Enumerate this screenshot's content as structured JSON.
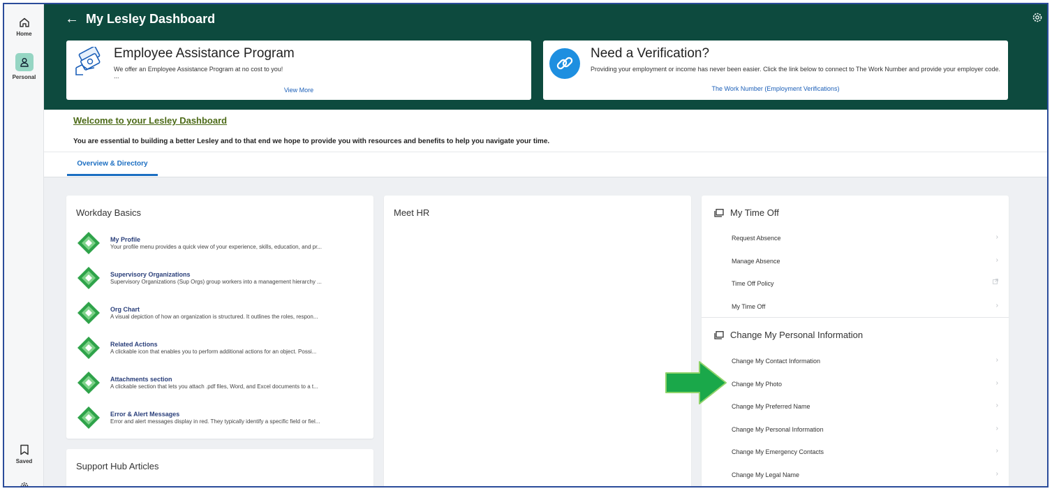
{
  "rail": {
    "home_label": "Home",
    "personal_label": "Personal",
    "saved_label": "Saved"
  },
  "header": {
    "title": "My Lesley Dashboard"
  },
  "promos": {
    "eap": {
      "title": "Employee Assistance Program",
      "description": "We offer an Employee Assistance Program at no cost to you!",
      "ellipsis": "...",
      "link": "View More"
    },
    "verification": {
      "title": "Need a Verification?",
      "description": "Providing your employment or income has never been easier. Click the link below to connect to The Work Number and provide your employer code.",
      "link": "The Work Number (Employment Verifications)"
    }
  },
  "welcome": {
    "heading": "Welcome to your Lesley Dashboard",
    "text": "You are essential to building a better Lesley and to that end we hope to provide you with resources and benefits to help you navigate your time."
  },
  "tabs": [
    {
      "label": "Overview & Directory",
      "active": true
    }
  ],
  "workday_basics": {
    "title": "Workday Basics",
    "items": [
      {
        "title": "My Profile",
        "desc": "Your profile menu provides a quick view of your experience, skills, education, and pr..."
      },
      {
        "title": "Supervisory Organizations",
        "desc": "Supervisory Organizations (Sup Orgs) group workers into a management hierarchy ..."
      },
      {
        "title": "Org Chart",
        "desc": "A visual depiction of how an organization is structured. It outlines the roles, respon..."
      },
      {
        "title": "Related Actions",
        "desc": "A clickable icon that enables you to perform additional actions for an object. Possi..."
      },
      {
        "title": "Attachments section",
        "desc": "A clickable section that lets you attach .pdf files, Word, and Excel documents to a t..."
      },
      {
        "title": "Error & Alert Messages",
        "desc": "Error and alert messages display in red. They typically identify a specific field or fiel..."
      }
    ]
  },
  "support_hub": {
    "title": "Support Hub Articles"
  },
  "meet_hr": {
    "title": "Meet HR"
  },
  "time_off": {
    "title": "My Time Off",
    "links": [
      "Request Absence",
      "Manage Absence",
      "Time Off Policy",
      "My Time Off"
    ]
  },
  "personal_info": {
    "title": "Change My Personal Information",
    "links": [
      "Change My Contact Information",
      "Change My Photo",
      "Change My Preferred Name",
      "Change My Personal Information",
      "Change My Emergency Contacts",
      "Change My Legal Name"
    ]
  },
  "colors": {
    "header_bg": "#0d4a3e",
    "accent_blue": "#1b6ec2",
    "welcome_green": "#4c6a17",
    "arrow_green": "#1aa84a"
  },
  "icons": {
    "rail": [
      "home-icon",
      "person-icon",
      "bookmark-icon",
      "gear-icon"
    ],
    "links": [
      "chevron-right-icon",
      "external-link-icon"
    ]
  }
}
